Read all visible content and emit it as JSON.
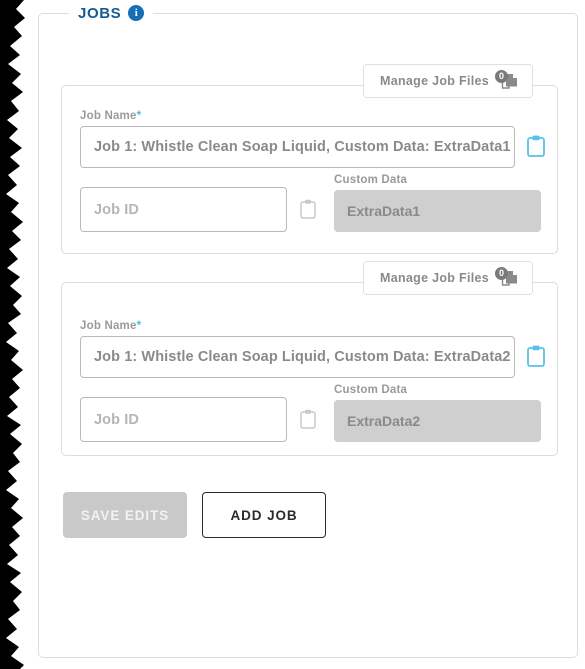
{
  "panel": {
    "legend": "JOBS",
    "info_icon": "info-icon",
    "info_tooltip": "i"
  },
  "jobs": [
    {
      "manage_files": {
        "label": "Manage Job Files",
        "badge_count": "0",
        "icon": "files-icon"
      },
      "job_name": {
        "label": "Job Name",
        "required_marker": "*",
        "value": "Job 1: Whistle Clean Soap Liquid, Custom Data: ExtraData1",
        "copy_icon": "clipboard-icon"
      },
      "job_id": {
        "placeholder": "Job ID",
        "value": "",
        "copy_icon": "clipboard-icon"
      },
      "custom_data": {
        "label": "Custom Data",
        "value": "ExtraData1"
      }
    },
    {
      "manage_files": {
        "label": "Manage Job Files",
        "badge_count": "0",
        "icon": "files-icon"
      },
      "job_name": {
        "label": "Job Name",
        "required_marker": "*",
        "value": "Job 1: Whistle Clean Soap Liquid, Custom Data: ExtraData2",
        "copy_icon": "clipboard-icon"
      },
      "job_id": {
        "placeholder": "Job ID",
        "value": "",
        "copy_icon": "clipboard-icon"
      },
      "custom_data": {
        "label": "Custom Data",
        "value": "ExtraData2"
      }
    }
  ],
  "actions": {
    "save_label": "SAVE EDITS",
    "add_label": "ADD JOB"
  },
  "colors": {
    "legend_blue": "#125c96",
    "info_blue": "#1470b5",
    "required_star": "#4ab8ea",
    "active_clip": "#5bc0ea",
    "inactive_clip": "#c9c9c9",
    "disabled_fill": "#cfcfcf",
    "label_gray": "#9a9a9a",
    "value_gray": "#8a8a8a",
    "border_gray": "#dcdcdc"
  }
}
